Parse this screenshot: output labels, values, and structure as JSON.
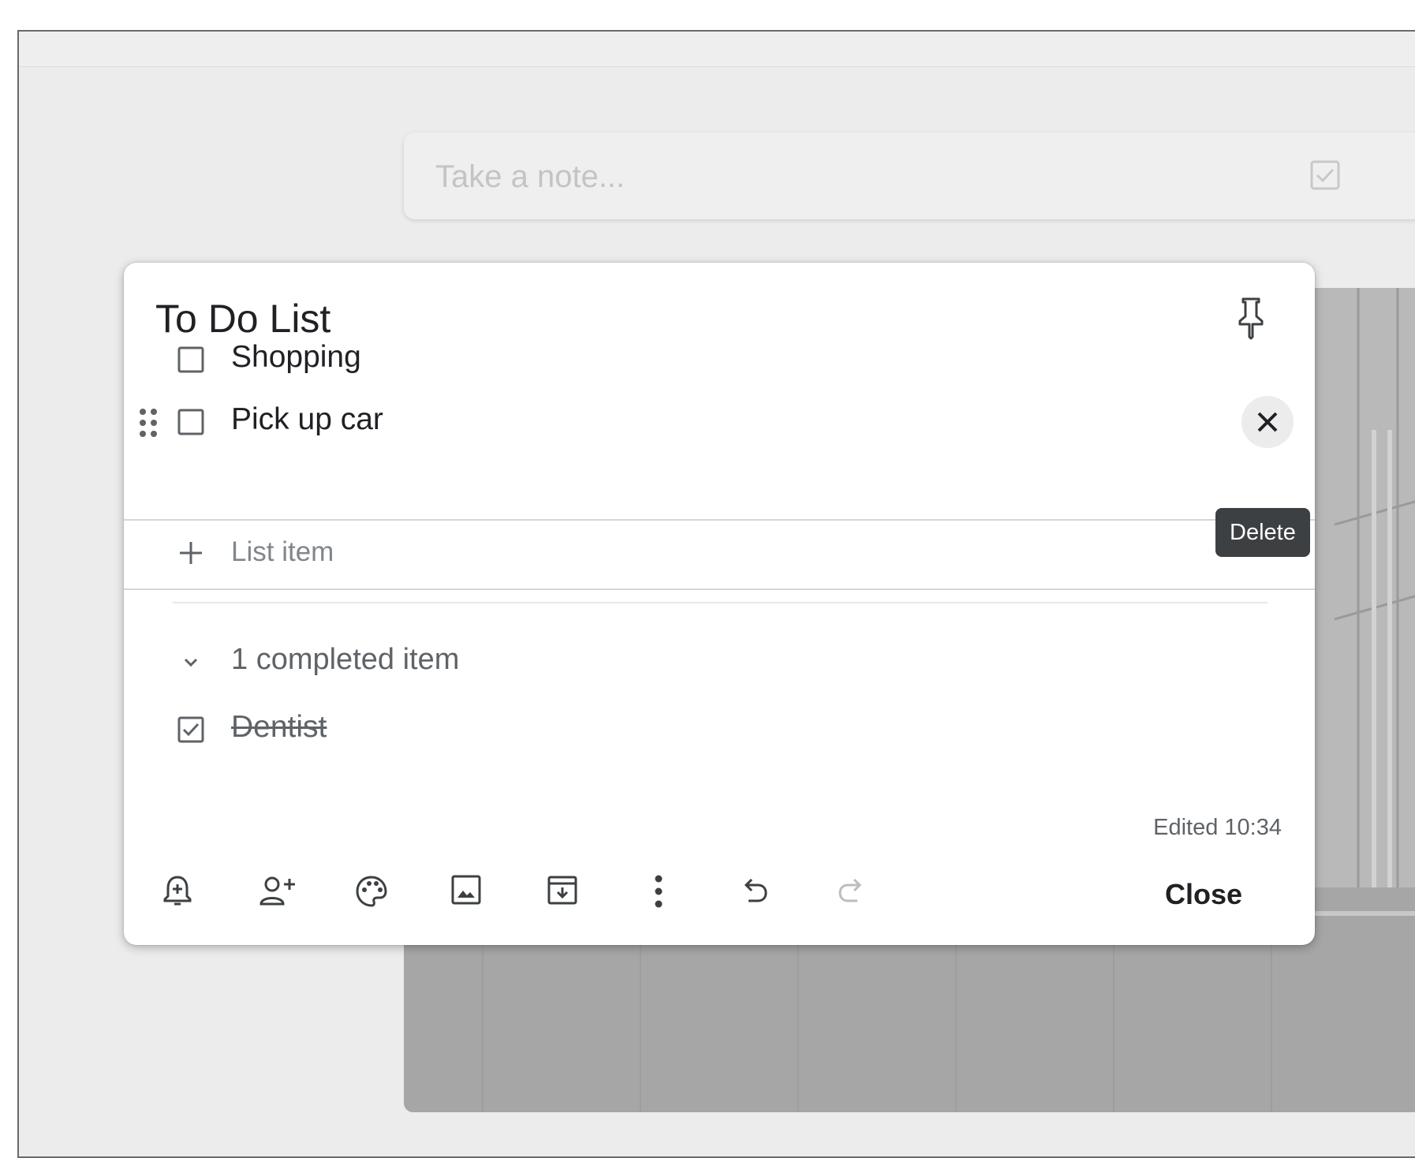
{
  "search": {
    "placeholder": "Take a note..."
  },
  "note": {
    "title": "To Do List",
    "items": [
      {
        "label": "Shopping",
        "checked": false
      },
      {
        "label": "Pick up car",
        "checked": false
      }
    ],
    "add_item_label": "List item",
    "completed_header": "1 completed item",
    "completed_items": [
      {
        "label": "Dentist",
        "checked": true
      }
    ],
    "edited": "Edited 10:34",
    "delete_tooltip": "Delete",
    "close_label": "Close"
  },
  "toolbar": {
    "icons": [
      "remind-me-icon",
      "collaborator-icon",
      "palette-icon",
      "add-image-icon",
      "archive-icon",
      "more-icon",
      "undo-icon",
      "redo-icon"
    ]
  },
  "colors": {
    "background": "#ececec",
    "card": "#ffffff",
    "text": "#202124",
    "muted": "#5f6368",
    "tooltip": "#3c4043"
  }
}
